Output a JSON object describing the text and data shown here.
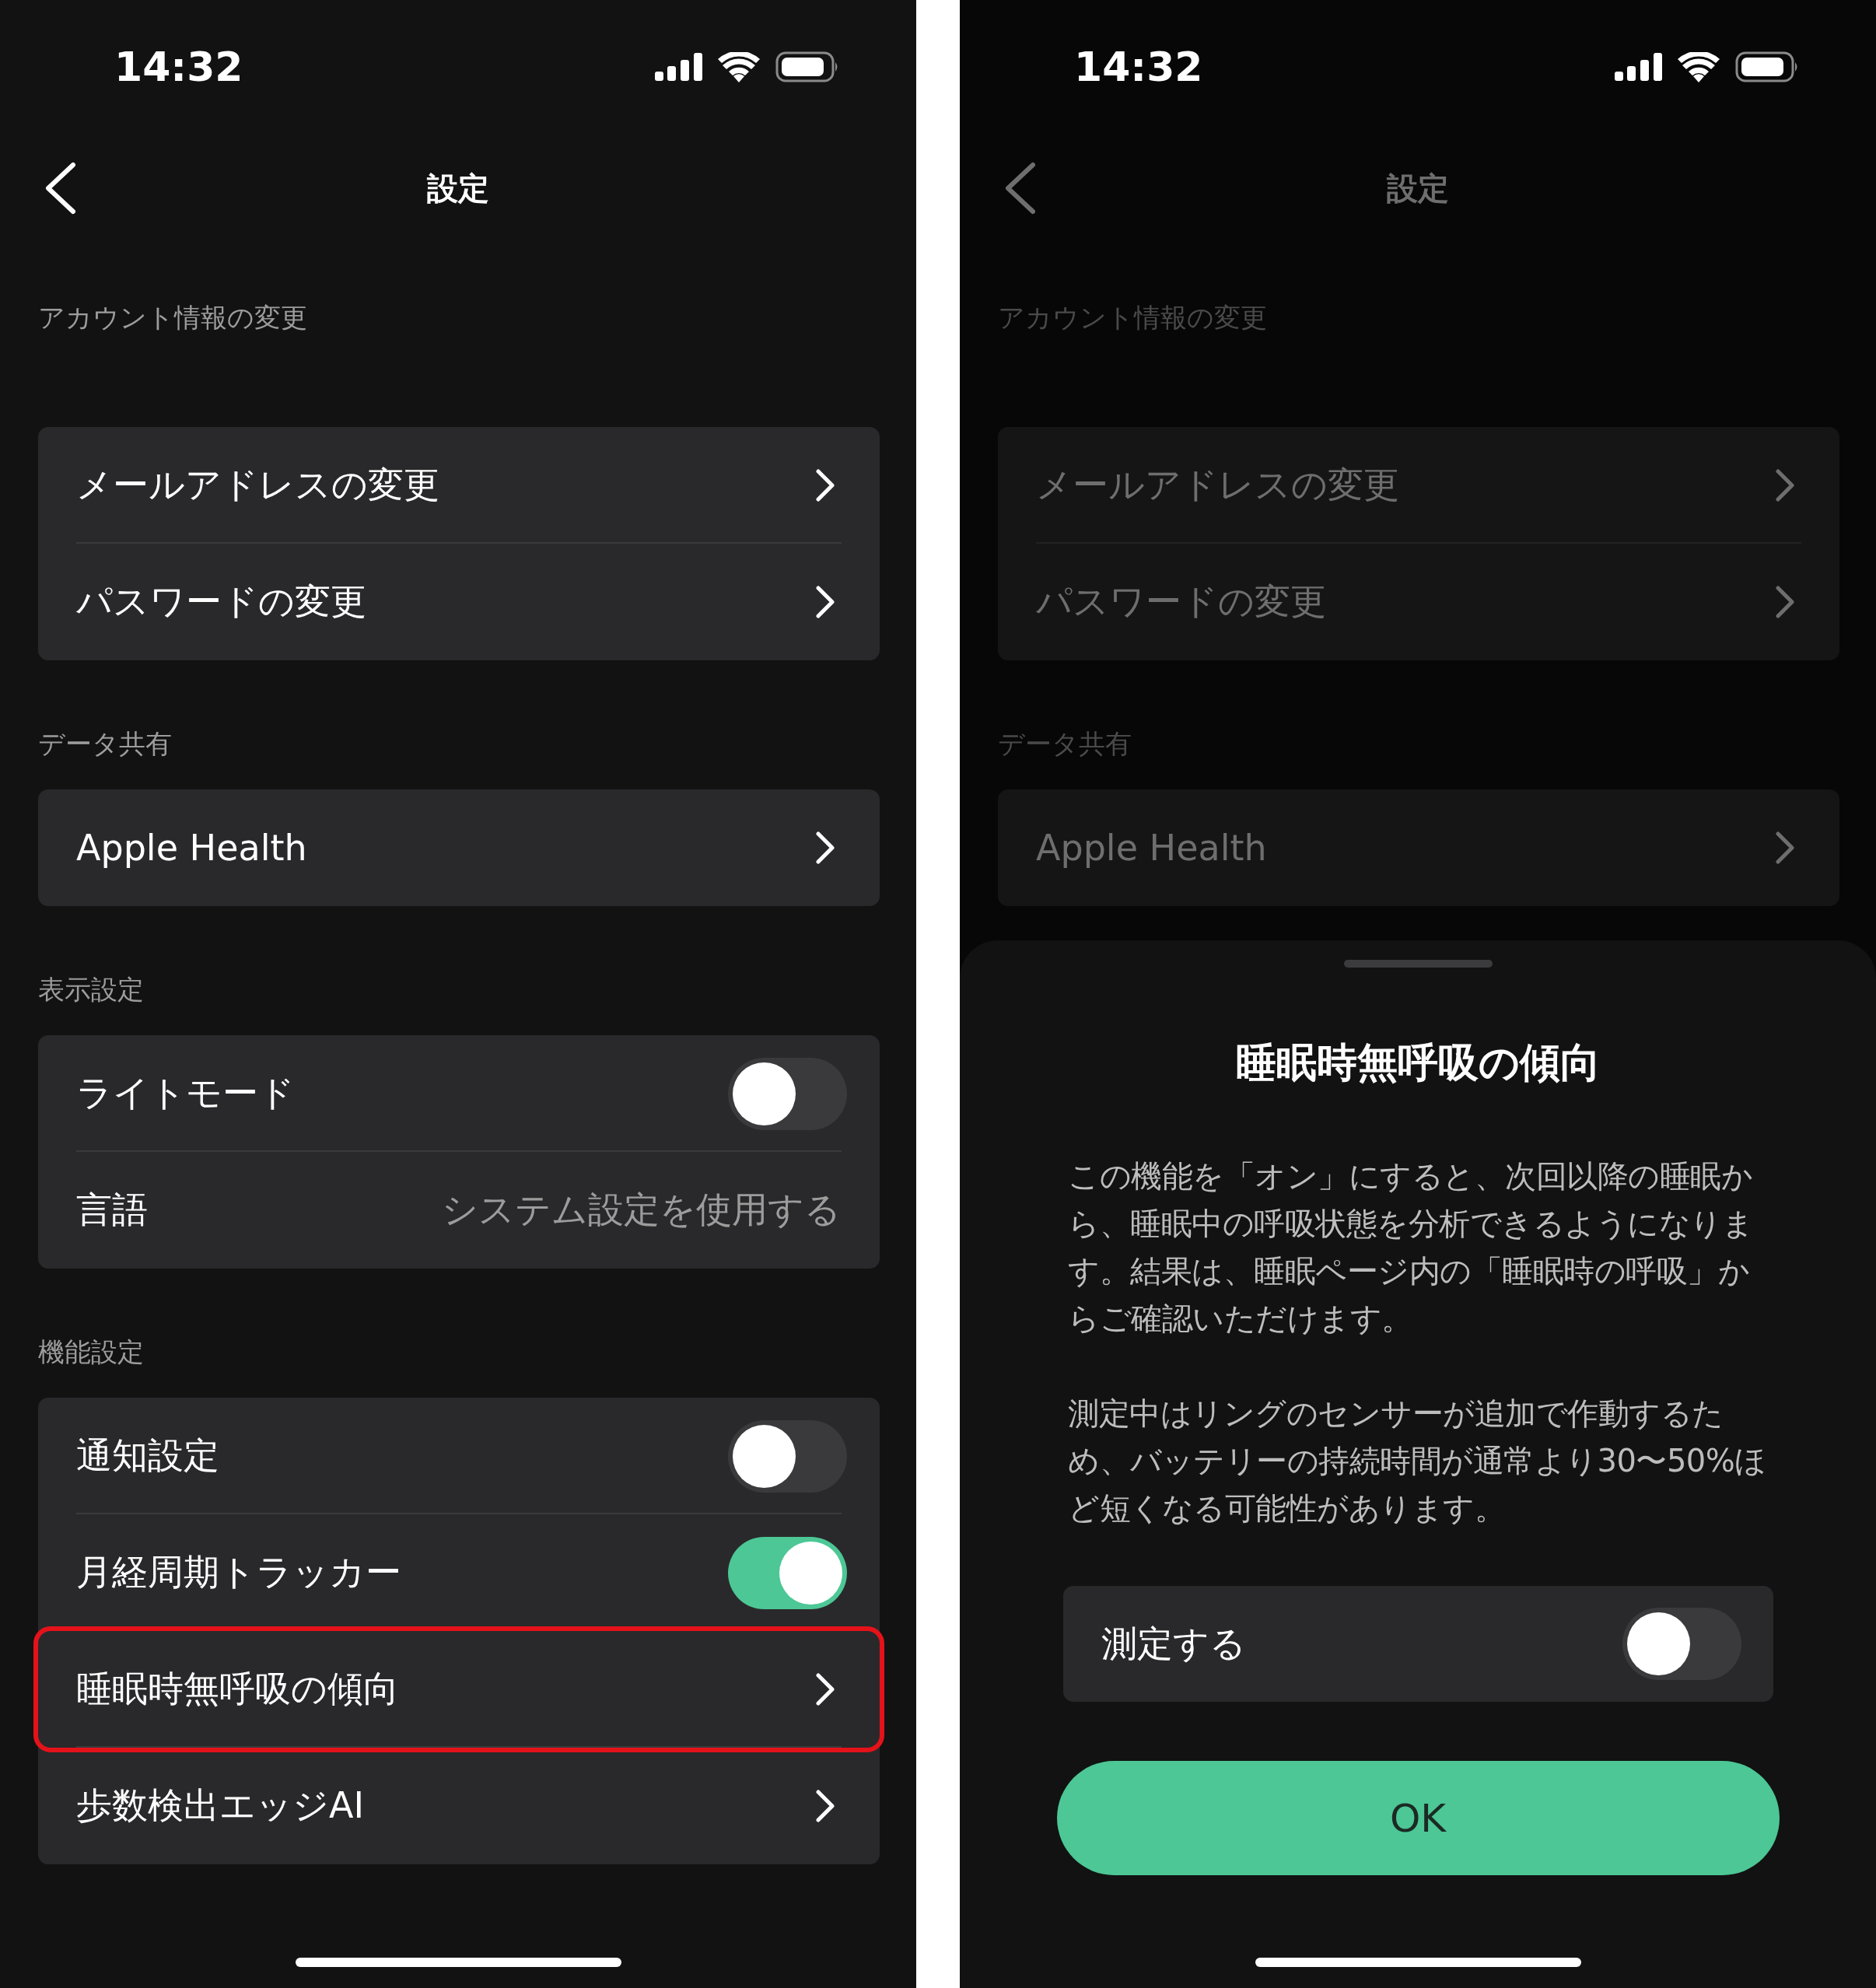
{
  "screens": [
    {
      "time": "14:32",
      "title": "設定",
      "dimmed": false,
      "sections": [
        {
          "header": "アカウント情報の変更",
          "rows": [
            {
              "kind": "link",
              "label": "メールアドレスの変更",
              "highlighted": false
            },
            {
              "kind": "link",
              "label": "パスワードの変更",
              "highlighted": false
            }
          ]
        },
        {
          "header": "データ共有",
          "rows": [
            {
              "kind": "link",
              "label": "Apple Health",
              "highlighted": false
            }
          ]
        },
        {
          "header": "表示設定",
          "rows": [
            {
              "kind": "toggle",
              "label": "ライトモード",
              "on": false,
              "highlighted": false
            },
            {
              "kind": "value",
              "label": "言語",
              "value": "システム設定を使用する",
              "highlighted": false
            }
          ]
        },
        {
          "header": "機能設定",
          "rows": [
            {
              "kind": "toggle",
              "label": "通知設定",
              "on": false,
              "highlighted": false
            },
            {
              "kind": "toggle",
              "label": "月経周期トラッカー",
              "on": true,
              "highlighted": false
            },
            {
              "kind": "link",
              "label": "睡眠時無呼吸の傾向",
              "highlighted": true
            },
            {
              "kind": "link",
              "label": "歩数検出エッジAI",
              "highlighted": false
            }
          ]
        }
      ]
    },
    {
      "time": "14:32",
      "title": "設定",
      "dimmed": true,
      "sections": [
        {
          "header": "アカウント情報の変更",
          "rows": [
            {
              "kind": "link",
              "label": "メールアドレスの変更",
              "highlighted": false
            },
            {
              "kind": "link",
              "label": "パスワードの変更",
              "highlighted": false
            }
          ]
        },
        {
          "header": "データ共有",
          "rows": [
            {
              "kind": "link",
              "label": "Apple Health",
              "highlighted": false
            }
          ]
        }
      ],
      "sheet": {
        "title": "睡眠時無呼吸の傾向",
        "paragraphs": [
          "この機能を「オン」にすると、次回以降の睡眠から、睡眠中の呼吸状態を分析できるようになります。結果は、睡眠ページ内の「睡眠時の呼吸」からご確認いただけます。",
          "測定中はリングのセンサーが追加で作動するため、バッテリーの持続時間が通常より30〜50%ほど短くなる可能性があります。"
        ],
        "toggle": {
          "label": "測定する",
          "on": false
        },
        "button": "OK"
      }
    }
  ]
}
